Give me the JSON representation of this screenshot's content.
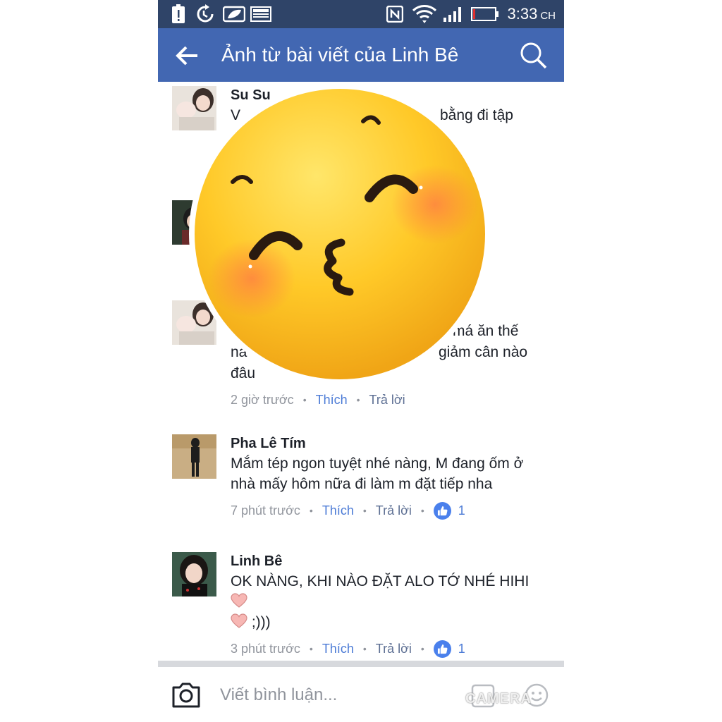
{
  "status_bar": {
    "time": "3:33",
    "ampm": "CH",
    "icons": [
      "alert-icon",
      "sync-icon",
      "leaf-icon",
      "image-icon",
      "nfc-icon",
      "wifi-icon",
      "signal-icon",
      "battery-icon"
    ]
  },
  "app_bar": {
    "title": "Ảnh từ bài viết của Linh Bê",
    "icons": [
      "back-arrow-icon",
      "search-icon"
    ]
  },
  "comments": [
    {
      "name": "Su Su",
      "text": "V",
      "text_right": "bằng đi tập"
    },
    {
      "name": "",
      "text": ""
    },
    {
      "name": "",
      "text_right_1": "má ăn thế",
      "text_line2_left": "nà",
      "text_right_2": "giảm cân nào",
      "text_line3": "đâu",
      "time": "2 giờ trước",
      "like": "Thích",
      "reply": "Trả lời"
    },
    {
      "name": "Pha Lê Tím",
      "text": "Mắm tép ngon tuyệt nhé nàng, M đang ốm ở nhà mấy hôm nữa đi làm m đặt tiếp nha",
      "time": "7 phút trước",
      "like": "Thích",
      "reply": "Trả lời",
      "likes": "1"
    },
    {
      "name": "Linh Bê",
      "text": "OK NÀNG, KHI NÀO ĐẶT ALO TỚ NHÉ HIHI",
      "text_after": ";)))",
      "time": "3 phút trước",
      "like": "Thích",
      "reply": "Trả lời",
      "likes": "1"
    }
  ],
  "composer": {
    "placeholder": "Viết bình luận...",
    "gif_label": "GIF",
    "watermark": "CAMERA",
    "icons": [
      "camera-icon",
      "gif-icon",
      "sticker-icon"
    ]
  },
  "colors": {
    "status_bar": "#2f4468",
    "app_bar": "#4267b2",
    "link": "#4c7bd6",
    "like_badge": "#4a80ec",
    "meta": "#90949c"
  }
}
